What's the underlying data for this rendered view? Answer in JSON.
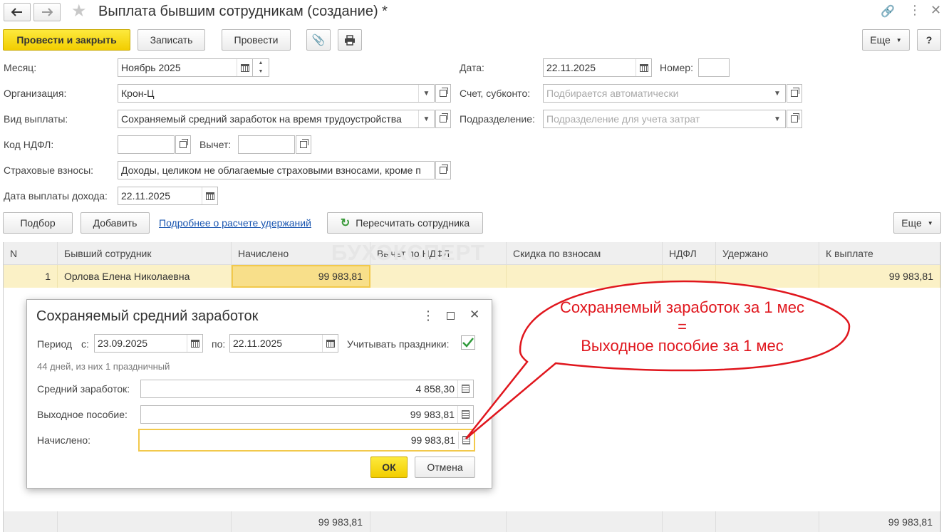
{
  "window": {
    "title": "Выплата бывшим сотрудникам (создание) *"
  },
  "toolbar": {
    "post_close": "Провести и закрыть",
    "save": "Записать",
    "post": "Провести",
    "more": "Еще",
    "help": "?"
  },
  "form": {
    "month_label": "Месяц:",
    "month_value": "Ноябрь 2025",
    "date_label": "Дата:",
    "date_value": "22.11.2025",
    "number_label": "Номер:",
    "number_value": "",
    "org_label": "Организация:",
    "org_value": "Крон-Ц",
    "account_label": "Счет, субконто:",
    "account_placeholder": "Подбирается автоматически",
    "paytype_label": "Вид выплаты:",
    "paytype_value": "Сохраняемый средний заработок на время трудоустройства",
    "dept_label": "Подразделение:",
    "dept_placeholder": "Подразделение для учета затрат",
    "ndfl_code_label": "Код НДФЛ:",
    "ndfl_code_value": "",
    "deduction_label": "Вычет:",
    "deduction_value": "",
    "insurance_label": "Страховые взносы:",
    "insurance_value": "Доходы, целиком не облагаемые страховыми взносами, кроме п",
    "income_date_label": "Дата выплаты дохода:",
    "income_date_value": "22.11.2025"
  },
  "table_toolbar": {
    "pick": "Подбор",
    "add": "Добавить",
    "details_link": "Подробнее о расчете удержаний",
    "recalc": "Пересчитать сотрудника",
    "more": "Еще"
  },
  "table": {
    "headers": [
      "N",
      "Бывший сотрудник",
      "Начислено",
      "Вычет по НДФЛ",
      "Скидка по взносам",
      "НДФЛ",
      "Удержано",
      "К выплате"
    ],
    "rows": [
      {
        "n": "1",
        "employee": "Орлова Елена Николаевна",
        "accrued": "99 983,81",
        "ndfl_deduction": "",
        "discount": "",
        "ndfl": "",
        "withheld": "",
        "to_pay": "99 983,81"
      }
    ],
    "footer": {
      "accrued": "99 983,81",
      "to_pay": "99 983,81"
    }
  },
  "watermark": "БУХЭКСПЕРТ",
  "dialog": {
    "title": "Сохраняемый средний заработок",
    "period_label": "Период",
    "from_label": "с:",
    "from_value": "23.09.2025",
    "to_label": "по:",
    "to_value": "22.11.2025",
    "holidays_label": "Учитывать праздники:",
    "holidays_checked": true,
    "days_info": "44 дней, из них 1 праздничный",
    "avg_label": "Средний заработок:",
    "avg_value": "4 858,30",
    "severance_label": "Выходное пособие:",
    "severance_value": "99 983,81",
    "accrued_label": "Начислено:",
    "accrued_value": "99 983,81",
    "ok": "ОК",
    "cancel": "Отмена"
  },
  "callout": {
    "line1": "Сохраняемый заработок за 1 мес",
    "line2": "=",
    "line3": "Выходное пособие за 1 мес",
    "color": "#e0161d"
  },
  "colors": {
    "accent": "#f2cd00",
    "row_highlight": "#fbf1c6",
    "link": "#1a56b0"
  }
}
